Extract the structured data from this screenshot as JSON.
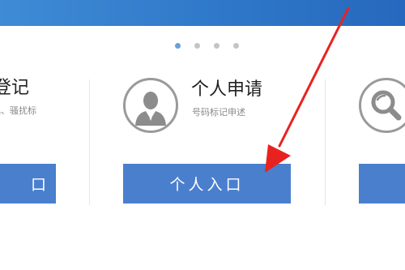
{
  "colors": {
    "banner": "#2f78c9",
    "button": "#4a7fce",
    "arrow": "#e8231f"
  },
  "carousel": {
    "total": 4,
    "active_index": 0
  },
  "cards": {
    "left": {
      "title": "登记",
      "subtitle": "记、骚扰标",
      "button_label": "口"
    },
    "center": {
      "title": "个人申请",
      "subtitle": "号码标记申述",
      "button_label": "个人入口",
      "icon": "person-icon"
    },
    "right": {
      "icon": "search-icon"
    }
  }
}
